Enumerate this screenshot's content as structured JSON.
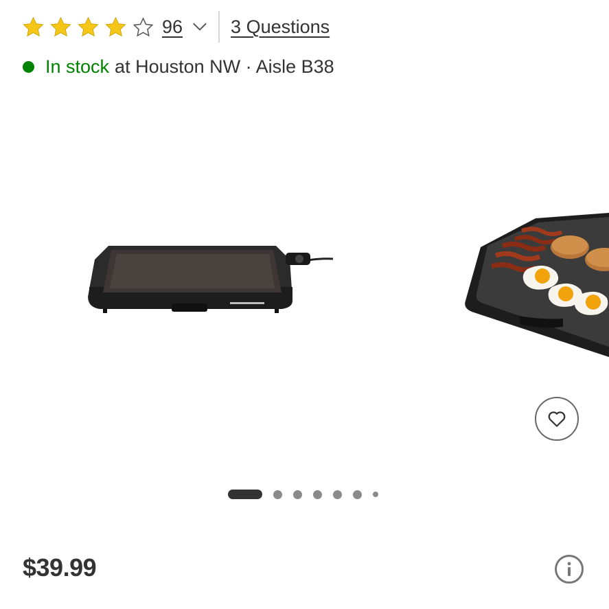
{
  "rating": {
    "value": 4,
    "max": 5,
    "filled_color": "#F5C518",
    "review_count": "96",
    "questions_label": "3 Questions"
  },
  "stock": {
    "status": "In stock",
    "location": "at Houston NW · Aisle B38",
    "status_color": "#008300"
  },
  "carousel": {
    "image_count": 7,
    "active_index": 1,
    "images": [
      {
        "icon": "electric-griddle-image"
      },
      {
        "icon": "griddle-with-breakfast-image"
      }
    ],
    "wishlist_icon": "heart-icon"
  },
  "price": {
    "amount": "$39.99",
    "info_icon": "info-icon"
  }
}
